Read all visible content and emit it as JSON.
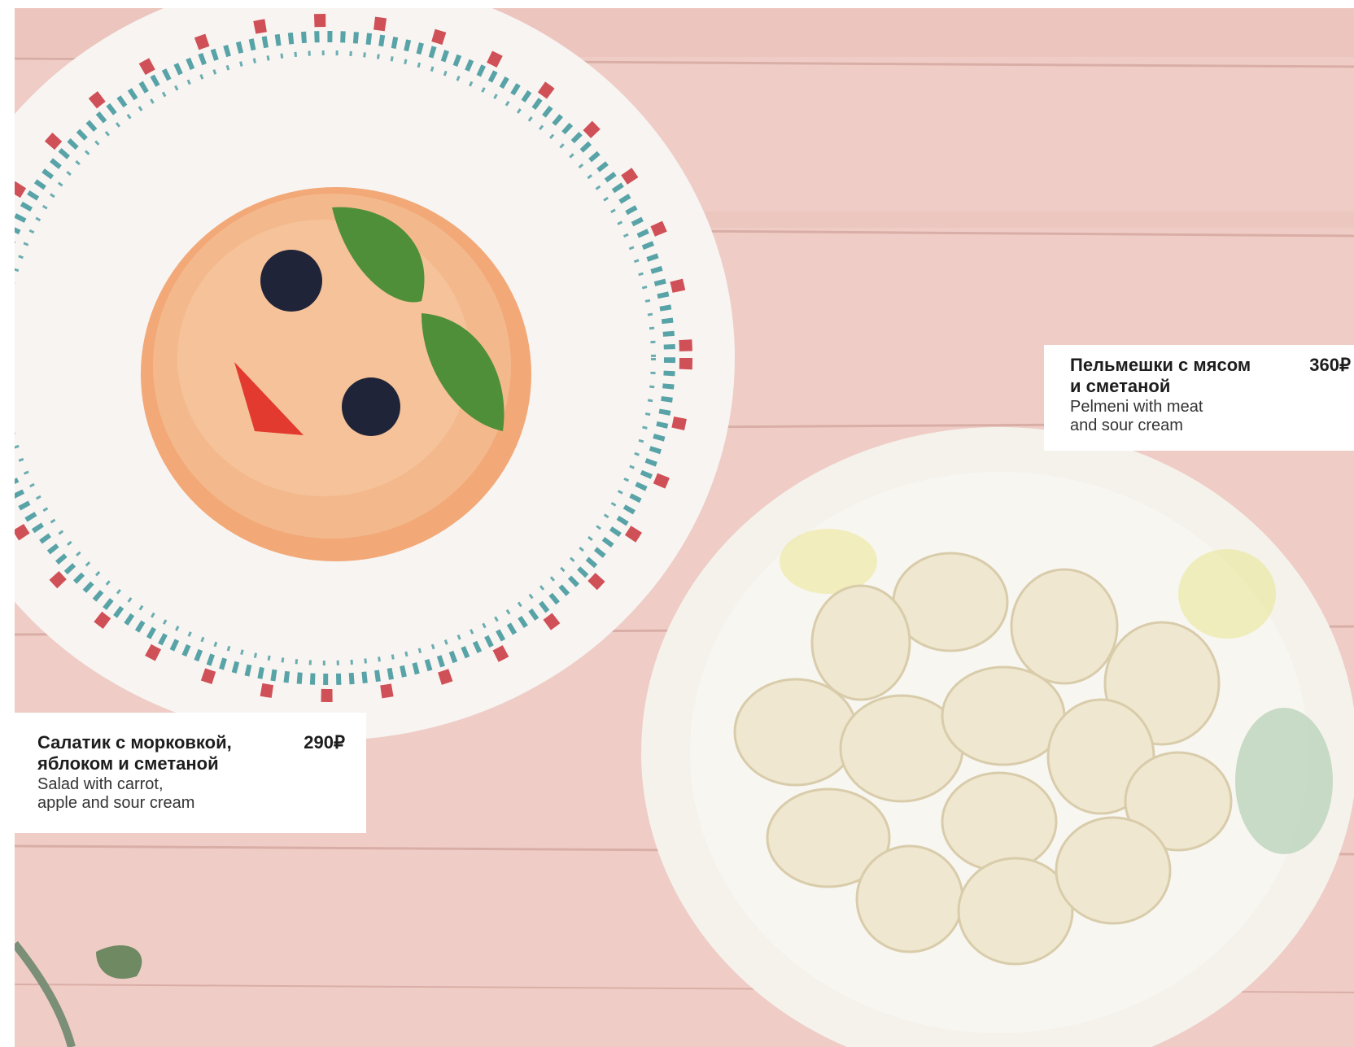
{
  "items": [
    {
      "name_ru": "Салатик с морковкой,\nяблоком и сметаной",
      "name_en": "Salad with carrot,\napple and sour cream",
      "price": "290₽"
    },
    {
      "name_ru": "Пельмешки с мясом\nи сметаной",
      "name_en": "Pelmeni with meat\nand sour cream",
      "price": "360₽"
    }
  ],
  "colors": {
    "table": "#efcdc6",
    "plate": "#f6f3f0",
    "salad": "#f0a070",
    "text": "#1d1d1d"
  }
}
